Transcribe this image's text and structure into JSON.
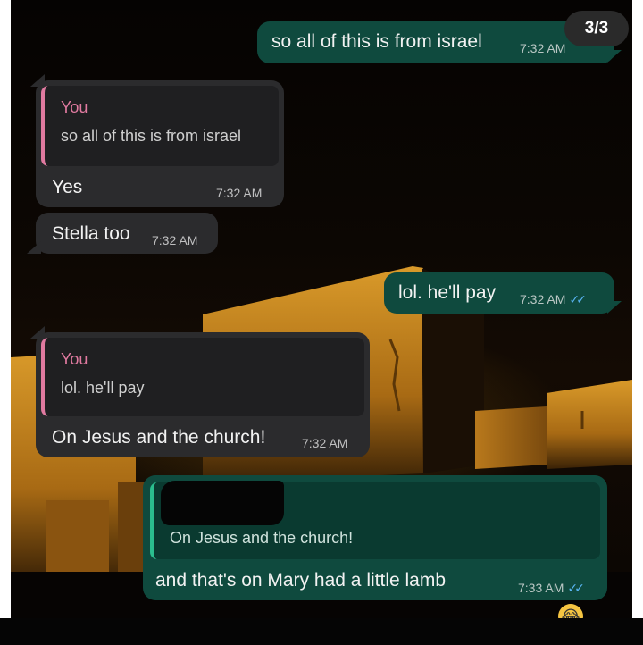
{
  "page_indicator": "3/3",
  "messages": [
    {
      "side": "out",
      "text": "so all of this is from israel",
      "time": "7:32 AM"
    },
    {
      "side": "in",
      "quote_author": "You",
      "quote_text": "so all of this is from israel",
      "text": "Yes",
      "time": "7:32 AM"
    },
    {
      "side": "in",
      "text": "Stella too",
      "time": "7:32 AM"
    },
    {
      "side": "out",
      "text": "lol. he'll pay",
      "time": "7:32 AM",
      "read": true
    },
    {
      "side": "in",
      "quote_author": "You",
      "quote_text": "lol. he'll pay",
      "text": "On Jesus and the church!",
      "time": "7:32 AM"
    },
    {
      "side": "out",
      "quote_text": "On Jesus and the church!",
      "text": "and that's on Mary had a little lamb",
      "time": "7:33 AM",
      "read": true
    }
  ],
  "colors": {
    "incoming_bubble": "#2b2b2d",
    "outgoing_bubble": "#0f4a3e",
    "quote_bar_you": "#e07aa0",
    "read_ticks": "#58b4f2"
  },
  "icons": {
    "read_receipt": "double-check-icon",
    "reaction": "laughing-emoji-icon"
  }
}
